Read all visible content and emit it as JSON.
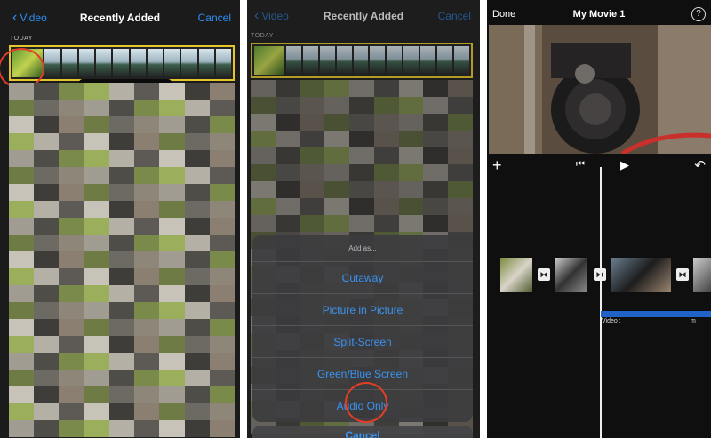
{
  "panel1": {
    "back_label": "Video",
    "title": "Recently Added",
    "cancel_label": "Cancel",
    "section": "TODAY"
  },
  "panel2": {
    "back_label": "Video",
    "title": "Recently Added",
    "cancel_label": "Cancel",
    "section": "TODAY",
    "sheet": {
      "title": "Add as...",
      "options": [
        "Cutaway",
        "Picture in Picture",
        "Split-Screen",
        "Green/Blue Screen",
        "Audio Only"
      ],
      "cancel_label": "Cancel"
    }
  },
  "panel3": {
    "done_label": "Done",
    "title": "My Movie 1",
    "help_icon": "?",
    "audio_track_label": "Video :",
    "audio_track_suffix": "m"
  },
  "colors": {
    "accent": "#2f8ff5",
    "highlight_ring": "#e33d25",
    "selection_border": "#e4c52a",
    "audio_track": "#2062c8"
  }
}
